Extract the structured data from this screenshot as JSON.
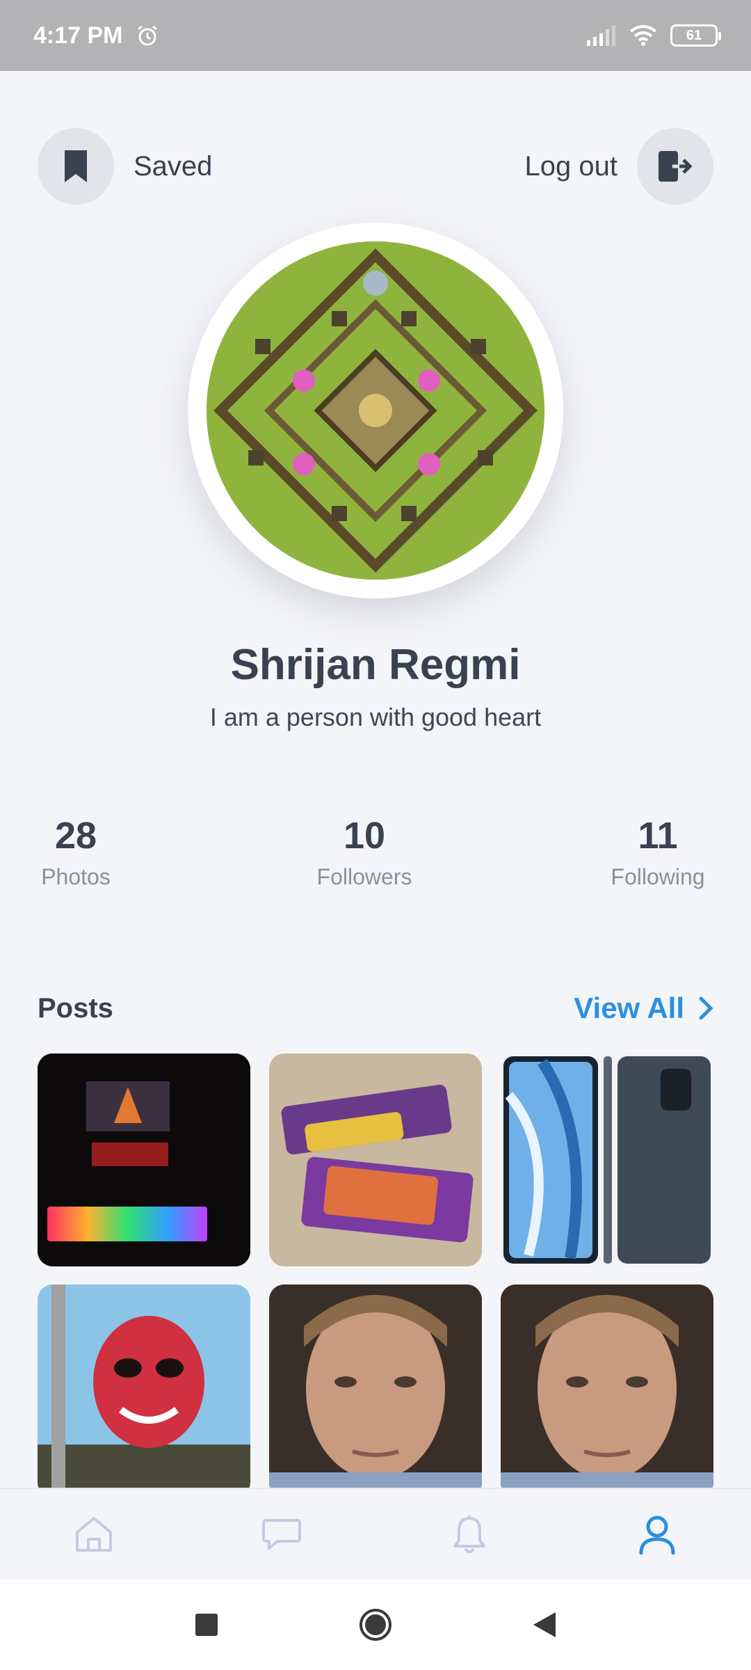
{
  "status_bar": {
    "time": "4:17 PM",
    "battery": "61",
    "icons": [
      "alarm-icon",
      "signal-icon",
      "wifi-icon",
      "battery-icon"
    ]
  },
  "top_actions": {
    "saved_label": "Saved",
    "logout_label": "Log out"
  },
  "profile": {
    "name": "Shrijan Regmi",
    "bio": "I am a person with good heart"
  },
  "stats": [
    {
      "value": "28",
      "label": "Photos"
    },
    {
      "value": "10",
      "label": "Followers"
    },
    {
      "value": "11",
      "label": "Following"
    }
  ],
  "posts": {
    "title": "Posts",
    "view_all": "View All",
    "thumbnails": [
      "gaming-laptop-photo",
      "chocolate-bars-photo",
      "phone-photo",
      "painted-face-photo",
      "portrait-photo",
      "portrait-photo"
    ]
  },
  "bottom_nav": {
    "items": [
      "home-icon",
      "chat-icon",
      "bell-icon",
      "profile-icon"
    ],
    "active": "profile-icon"
  },
  "colors": {
    "accent": "#2b8fe0",
    "background": "#f4f5f9",
    "text": "#3a4150",
    "muted": "#8a909c",
    "inactive_nav": "#c4cbe0"
  }
}
